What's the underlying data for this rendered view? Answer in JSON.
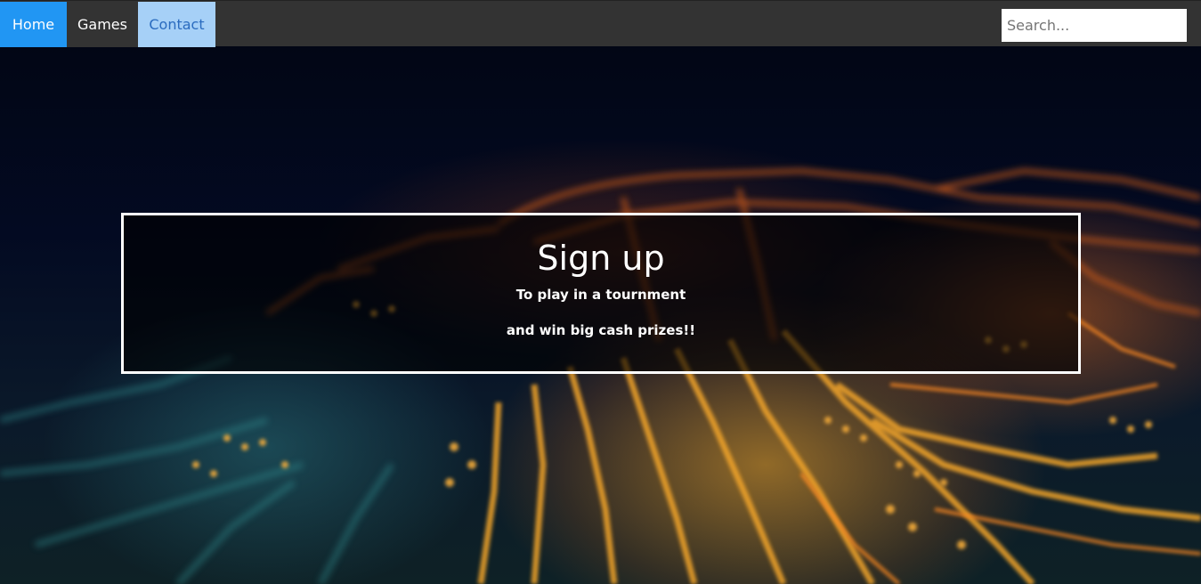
{
  "navbar": {
    "items": [
      {
        "label": "Home"
      },
      {
        "label": "Games"
      },
      {
        "label": "Contact"
      }
    ],
    "search": {
      "placeholder": "Search...",
      "value": ""
    }
  },
  "hero": {
    "title": "Sign up",
    "line1": "To play in a tournment",
    "line2": "and win big cash prizes!!"
  },
  "colors": {
    "nav_background": "#333333",
    "home_active": "#2196f3",
    "contact_highlight": "#a6d0f7",
    "box_border": "#ffffff"
  }
}
